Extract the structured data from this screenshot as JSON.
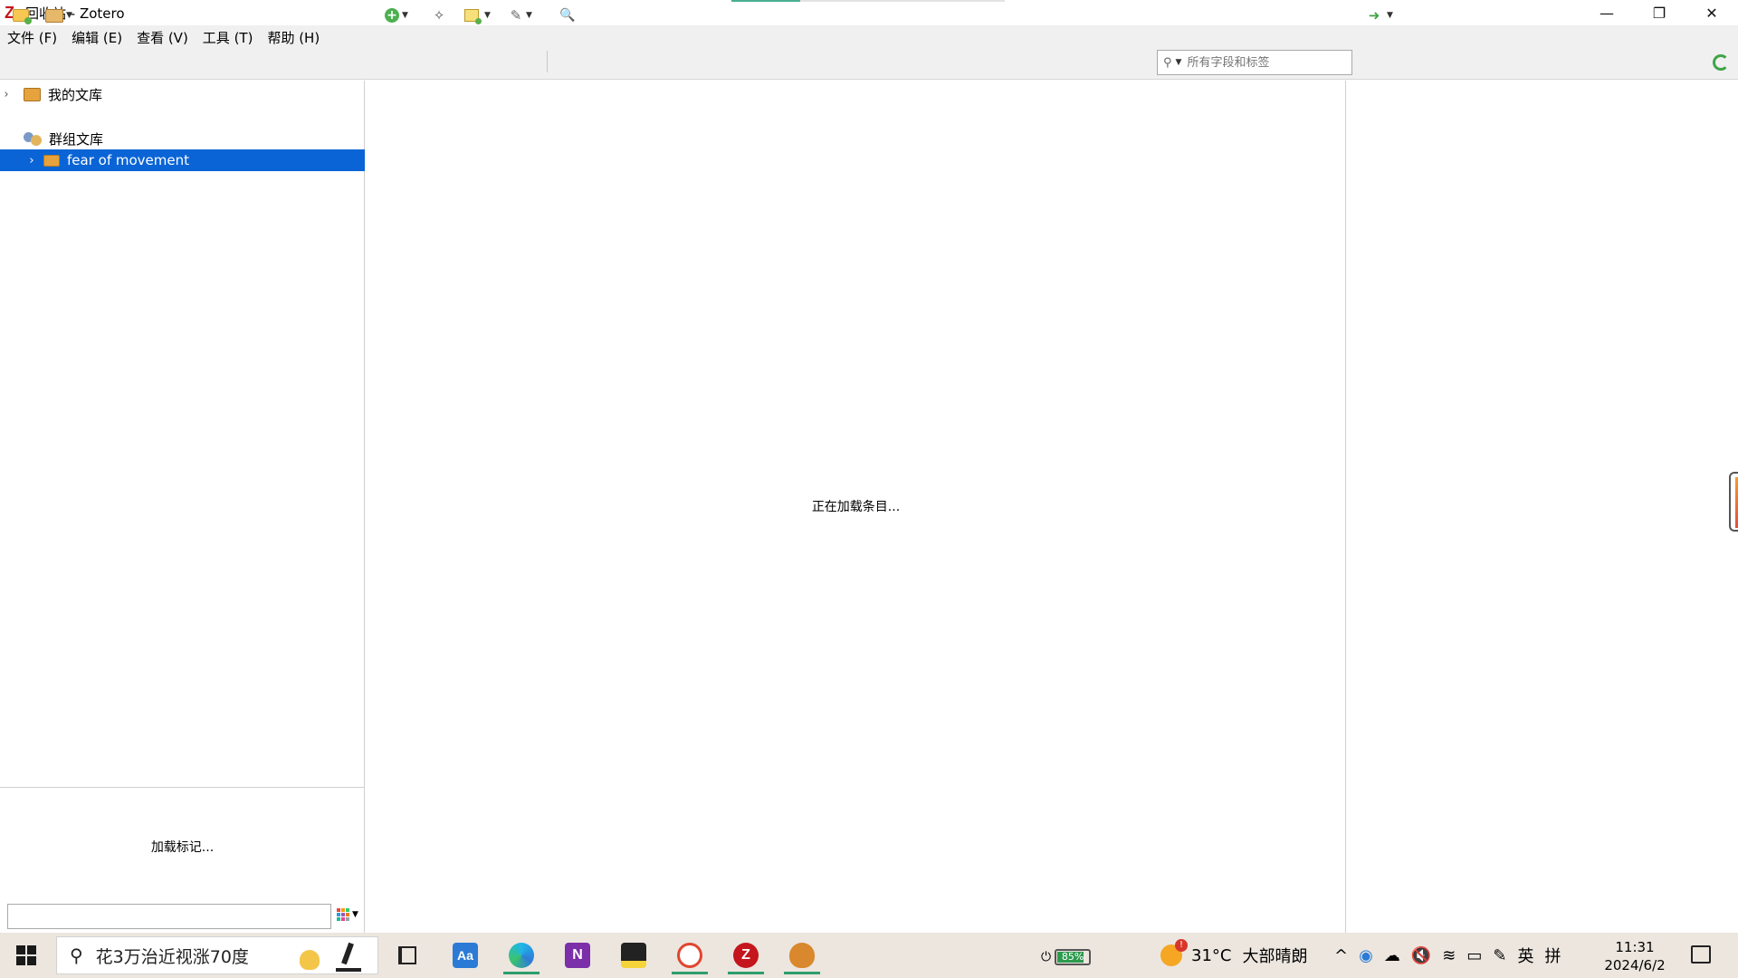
{
  "window": {
    "title": "回收站 - Zotero",
    "app_icon": "Z",
    "controls": {
      "minimize": "—",
      "maximize": "❐",
      "close": "✕"
    },
    "progress_fraction": 0.25
  },
  "menubar": {
    "items": [
      "文件 (F)",
      "编辑 (E)",
      "查看 (V)",
      "工具 (T)",
      "帮助 (H)"
    ]
  },
  "toolbar": {
    "icons": [
      "new-collection-icon",
      "new-library-icon",
      "new-item-icon",
      "add-by-identifier-icon",
      "new-note-icon",
      "attachment-icon",
      "advanced-search-icon",
      "locate-icon",
      "sync-icon"
    ],
    "search": {
      "placeholder": "所有字段和标签",
      "value": ""
    }
  },
  "collections": {
    "my_library": "我的文库",
    "group_header": "群组文库",
    "selected_group": "fear of movement"
  },
  "tag_selector": {
    "loading_text": "加载标记...",
    "filter_value": ""
  },
  "items_pane": {
    "loading_text": "正在加载条目..."
  },
  "taskbar": {
    "search_text": "花3万治近视涨70度",
    "apps": [
      {
        "name": "task-view",
        "label": ""
      },
      {
        "name": "dictionary",
        "label": "Aa",
        "color": "#2b7bd6"
      },
      {
        "name": "edge",
        "label": ""
      },
      {
        "name": "onenote",
        "label": "N",
        "color": "#7b2fa8"
      },
      {
        "name": "sticky-notes",
        "label": "",
        "color": "#222222"
      },
      {
        "name": "paint-app",
        "label": "",
        "color": "#e0462f"
      },
      {
        "name": "zotero",
        "label": "Z",
        "color": "#c4161c"
      },
      {
        "name": "acorn-app",
        "label": "",
        "color": "#d9882e"
      }
    ],
    "battery_percent": "85%",
    "battery_level": 0.85,
    "weather_temp": "31°C",
    "weather_desc": "大部晴朗",
    "ime_lang": "英",
    "ime_mode": "拼",
    "time": "11:31",
    "date": "2024/6/2"
  }
}
